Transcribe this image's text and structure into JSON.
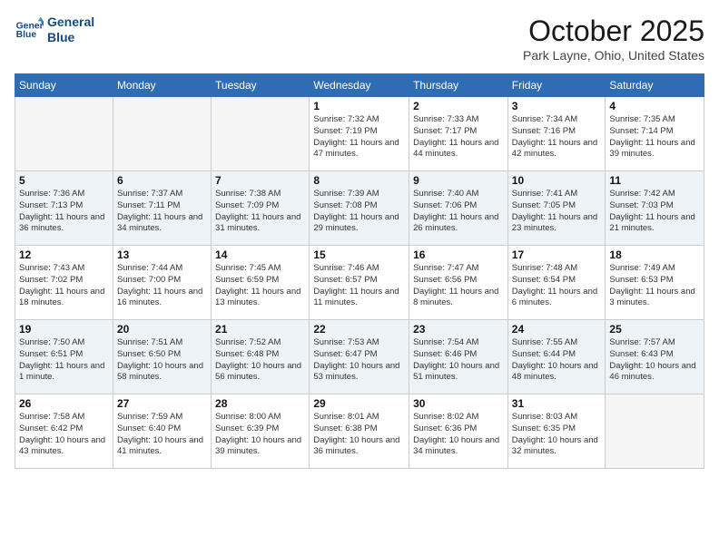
{
  "logo": {
    "line1": "General",
    "line2": "Blue"
  },
  "title": "October 2025",
  "subtitle": "Park Layne, Ohio, United States",
  "weekdays": [
    "Sunday",
    "Monday",
    "Tuesday",
    "Wednesday",
    "Thursday",
    "Friday",
    "Saturday"
  ],
  "weeks": [
    [
      {
        "day": "",
        "empty": true
      },
      {
        "day": "",
        "empty": true
      },
      {
        "day": "",
        "empty": true
      },
      {
        "day": "1",
        "sunrise": "7:32 AM",
        "sunset": "7:19 PM",
        "daylight": "11 hours and 47 minutes."
      },
      {
        "day": "2",
        "sunrise": "7:33 AM",
        "sunset": "7:17 PM",
        "daylight": "11 hours and 44 minutes."
      },
      {
        "day": "3",
        "sunrise": "7:34 AM",
        "sunset": "7:16 PM",
        "daylight": "11 hours and 42 minutes."
      },
      {
        "day": "4",
        "sunrise": "7:35 AM",
        "sunset": "7:14 PM",
        "daylight": "11 hours and 39 minutes."
      }
    ],
    [
      {
        "day": "5",
        "sunrise": "7:36 AM",
        "sunset": "7:13 PM",
        "daylight": "11 hours and 36 minutes."
      },
      {
        "day": "6",
        "sunrise": "7:37 AM",
        "sunset": "7:11 PM",
        "daylight": "11 hours and 34 minutes."
      },
      {
        "day": "7",
        "sunrise": "7:38 AM",
        "sunset": "7:09 PM",
        "daylight": "11 hours and 31 minutes."
      },
      {
        "day": "8",
        "sunrise": "7:39 AM",
        "sunset": "7:08 PM",
        "daylight": "11 hours and 29 minutes."
      },
      {
        "day": "9",
        "sunrise": "7:40 AM",
        "sunset": "7:06 PM",
        "daylight": "11 hours and 26 minutes."
      },
      {
        "day": "10",
        "sunrise": "7:41 AM",
        "sunset": "7:05 PM",
        "daylight": "11 hours and 23 minutes."
      },
      {
        "day": "11",
        "sunrise": "7:42 AM",
        "sunset": "7:03 PM",
        "daylight": "11 hours and 21 minutes."
      }
    ],
    [
      {
        "day": "12",
        "sunrise": "7:43 AM",
        "sunset": "7:02 PM",
        "daylight": "11 hours and 18 minutes."
      },
      {
        "day": "13",
        "sunrise": "7:44 AM",
        "sunset": "7:00 PM",
        "daylight": "11 hours and 16 minutes."
      },
      {
        "day": "14",
        "sunrise": "7:45 AM",
        "sunset": "6:59 PM",
        "daylight": "11 hours and 13 minutes."
      },
      {
        "day": "15",
        "sunrise": "7:46 AM",
        "sunset": "6:57 PM",
        "daylight": "11 hours and 11 minutes."
      },
      {
        "day": "16",
        "sunrise": "7:47 AM",
        "sunset": "6:56 PM",
        "daylight": "11 hours and 8 minutes."
      },
      {
        "day": "17",
        "sunrise": "7:48 AM",
        "sunset": "6:54 PM",
        "daylight": "11 hours and 6 minutes."
      },
      {
        "day": "18",
        "sunrise": "7:49 AM",
        "sunset": "6:53 PM",
        "daylight": "11 hours and 3 minutes."
      }
    ],
    [
      {
        "day": "19",
        "sunrise": "7:50 AM",
        "sunset": "6:51 PM",
        "daylight": "11 hours and 1 minute."
      },
      {
        "day": "20",
        "sunrise": "7:51 AM",
        "sunset": "6:50 PM",
        "daylight": "10 hours and 58 minutes."
      },
      {
        "day": "21",
        "sunrise": "7:52 AM",
        "sunset": "6:48 PM",
        "daylight": "10 hours and 56 minutes."
      },
      {
        "day": "22",
        "sunrise": "7:53 AM",
        "sunset": "6:47 PM",
        "daylight": "10 hours and 53 minutes."
      },
      {
        "day": "23",
        "sunrise": "7:54 AM",
        "sunset": "6:46 PM",
        "daylight": "10 hours and 51 minutes."
      },
      {
        "day": "24",
        "sunrise": "7:55 AM",
        "sunset": "6:44 PM",
        "daylight": "10 hours and 48 minutes."
      },
      {
        "day": "25",
        "sunrise": "7:57 AM",
        "sunset": "6:43 PM",
        "daylight": "10 hours and 46 minutes."
      }
    ],
    [
      {
        "day": "26",
        "sunrise": "7:58 AM",
        "sunset": "6:42 PM",
        "daylight": "10 hours and 43 minutes."
      },
      {
        "day": "27",
        "sunrise": "7:59 AM",
        "sunset": "6:40 PM",
        "daylight": "10 hours and 41 minutes."
      },
      {
        "day": "28",
        "sunrise": "8:00 AM",
        "sunset": "6:39 PM",
        "daylight": "10 hours and 39 minutes."
      },
      {
        "day": "29",
        "sunrise": "8:01 AM",
        "sunset": "6:38 PM",
        "daylight": "10 hours and 36 minutes."
      },
      {
        "day": "30",
        "sunrise": "8:02 AM",
        "sunset": "6:36 PM",
        "daylight": "10 hours and 34 minutes."
      },
      {
        "day": "31",
        "sunrise": "8:03 AM",
        "sunset": "6:35 PM",
        "daylight": "10 hours and 32 minutes."
      },
      {
        "day": "",
        "empty": true
      }
    ]
  ]
}
